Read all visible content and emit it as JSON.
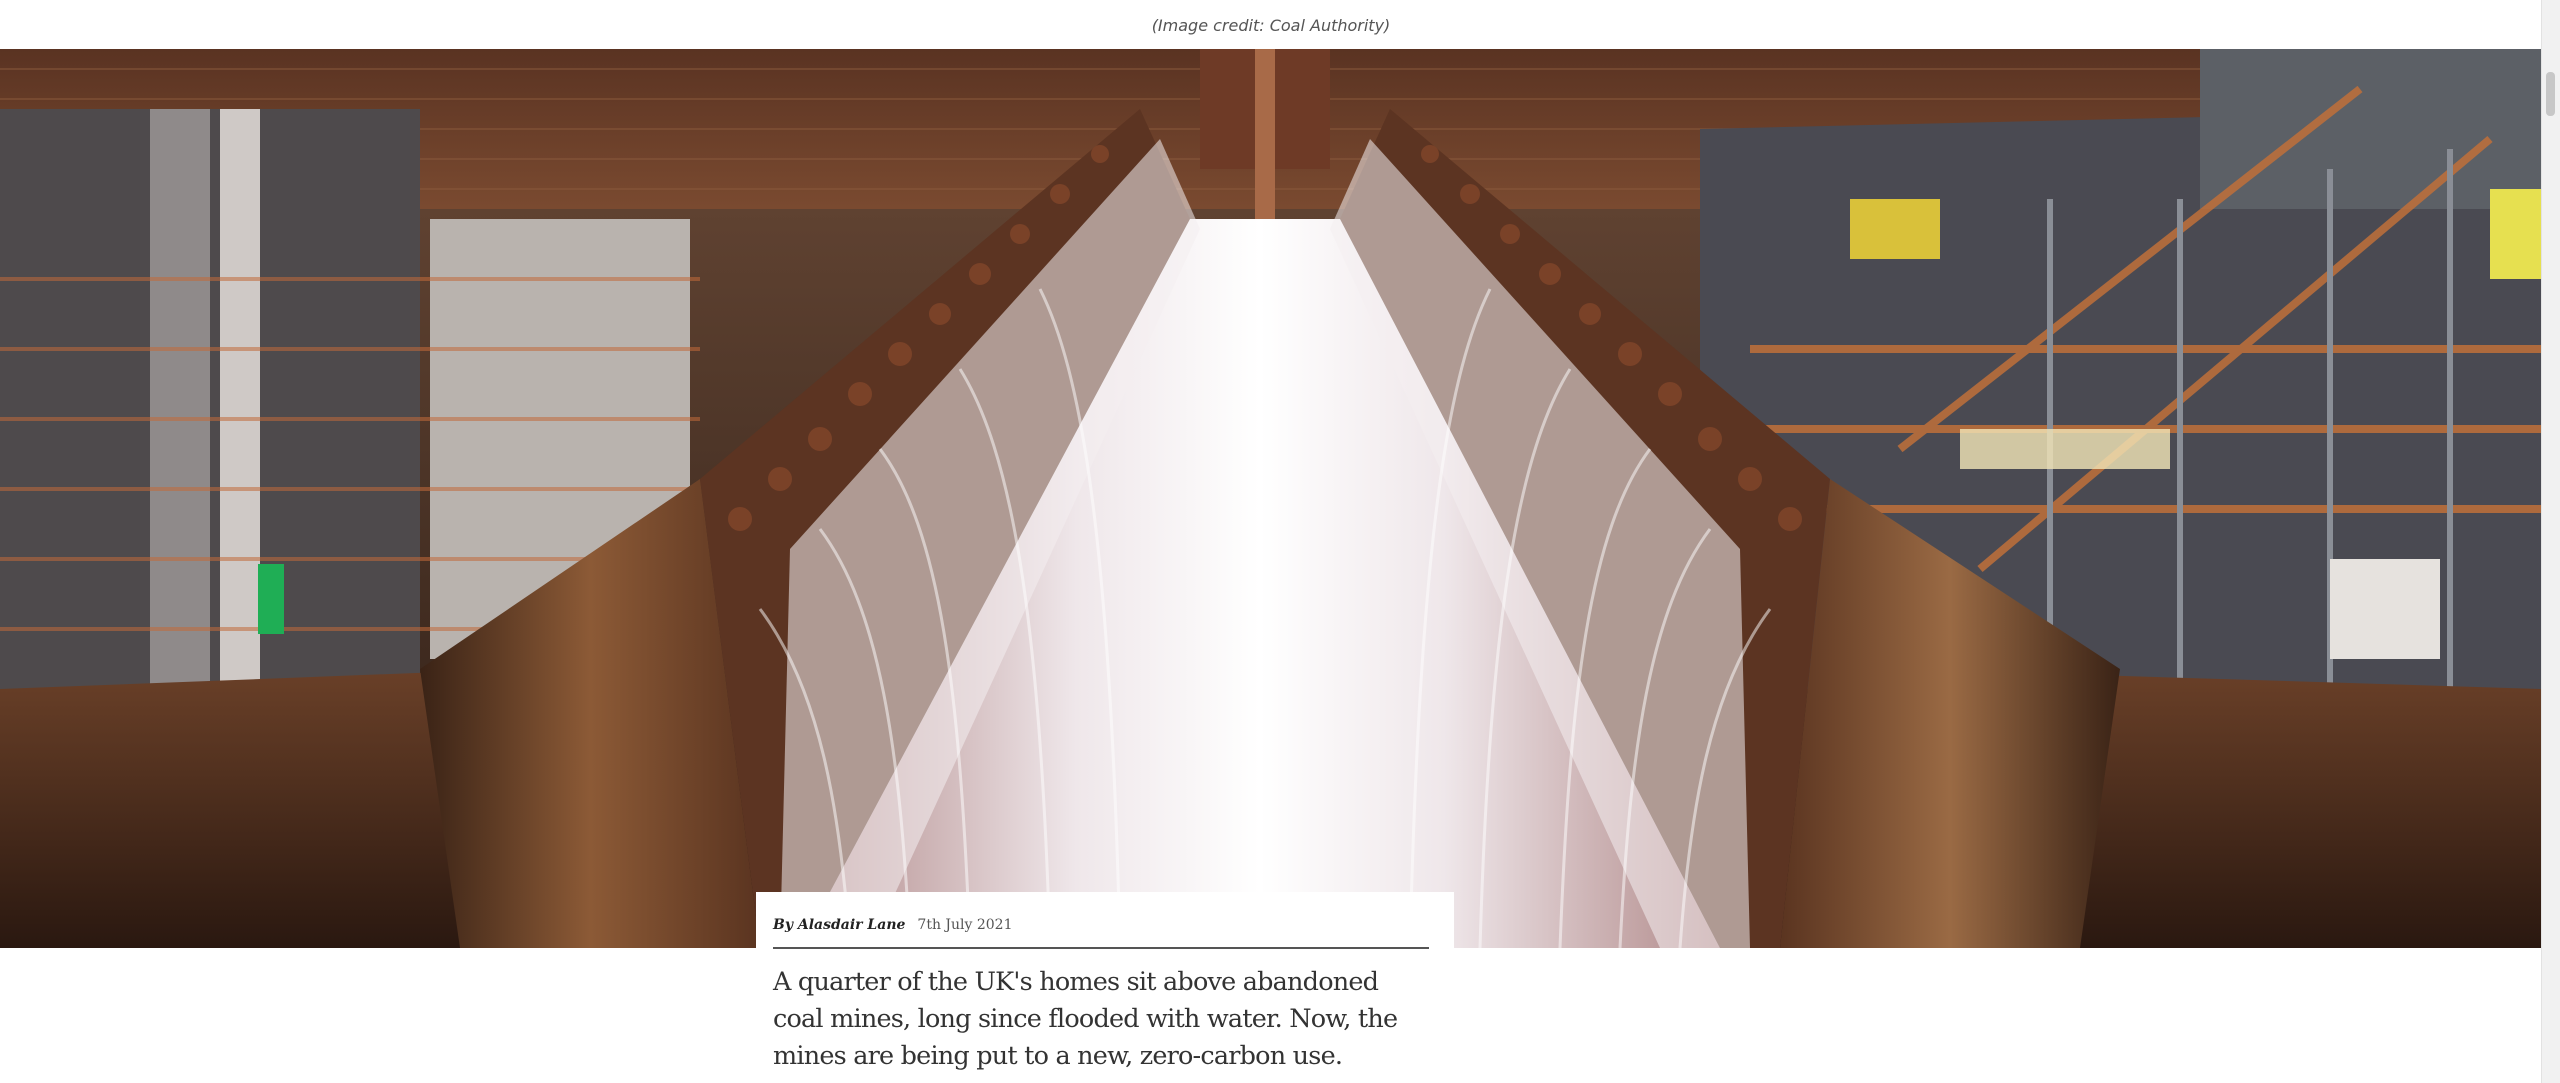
{
  "image": {
    "credit": "(Image credit: Coal Authority)",
    "subject": "hero-image"
  },
  "article": {
    "byline": "By Alasdair Lane",
    "date": "7th July 2021",
    "standfirst": "A quarter of the UK's homes sit above abandoned coal mines, long since flooded with water. Now, the mines are being put to a new, zero-carbon use."
  },
  "colors": {
    "rust": "#8a4a2a",
    "water": "#e9e2e4",
    "rule": "#555555"
  }
}
